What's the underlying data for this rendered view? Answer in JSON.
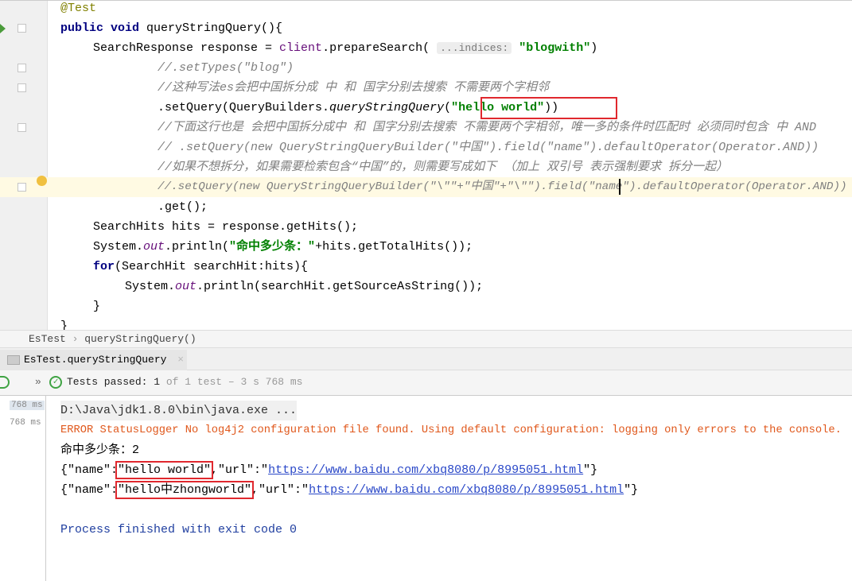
{
  "editor": {
    "lines": [
      {
        "indent": 0,
        "segs": [
          [
            "ann",
            "@Test"
          ]
        ]
      },
      {
        "indent": 0,
        "segs": [
          [
            "kw",
            "public void "
          ],
          [
            "",
            "queryStringQuery(){"
          ]
        ]
      },
      {
        "indent": 1,
        "segs": [
          [
            "",
            "SearchResponse response = "
          ],
          [
            "fld",
            "client"
          ],
          [
            "",
            ".prepareSearch( "
          ],
          [
            "hint",
            "...indices:"
          ],
          [
            "str",
            " \"blogwith\""
          ],
          [
            "",
            ")"
          ]
        ]
      },
      {
        "indent": 3,
        "segs": [
          [
            "cm",
            "//.setTypes(\"blog\")"
          ]
        ]
      },
      {
        "indent": 3,
        "segs": [
          [
            "cm",
            "//这种写法es会把中国拆分成 中 和 国字分别去搜索 不需要两个字相邻"
          ]
        ]
      },
      {
        "indent": 3,
        "segs": [
          [
            "",
            ".setQuery(QueryBuilders."
          ],
          [
            "it",
            "queryStringQuery"
          ],
          [
            "",
            "("
          ],
          [
            "str",
            "\"hello world\""
          ],
          [
            "",
            "))"
          ]
        ]
      },
      {
        "indent": 3,
        "segs": [
          [
            "cm",
            "//下面这行也是 会把中国拆分成中 和 国字分别去搜索 不需要两个字相邻，唯一多的条件时匹配时 必须同时包含 中 AND"
          ]
        ]
      },
      {
        "indent": 3,
        "segs": [
          [
            "cm",
            "// .setQuery(new QueryStringQueryBuilder(\"中国\").field(\"name\").defaultOperator(Operator.AND))"
          ]
        ]
      },
      {
        "indent": 3,
        "segs": [
          [
            "cm",
            "//如果不想拆分，如果需要检索包含“中国”的，则需要写成如下 （加上 双引号 表示强制要求 拆分一起）"
          ]
        ]
      },
      {
        "indent": 3,
        "segs": [
          [
            "cm",
            "//.setQuery(new QueryStringQueryBuilder(\"\\\"\"+\"中国\"+\"\\\"\").field(\"name\").defaultOperator(Operator.AND))"
          ]
        ]
      },
      {
        "indent": 3,
        "segs": [
          [
            "",
            ".get();"
          ]
        ]
      },
      {
        "indent": 1,
        "segs": [
          [
            "",
            "SearchHits hits = response.getHits();"
          ]
        ]
      },
      {
        "indent": 1,
        "segs": [
          [
            "",
            "System."
          ],
          [
            "fld it",
            "out"
          ],
          [
            "",
            ".println("
          ],
          [
            "str",
            "\"命中多少条：\""
          ],
          [
            "",
            "+hits.getTotalHits());"
          ]
        ]
      },
      {
        "indent": 1,
        "segs": [
          [
            "kw",
            "for"
          ],
          [
            "",
            "(SearchHit searchHit:hits){"
          ]
        ]
      },
      {
        "indent": 2,
        "segs": [
          [
            "",
            "System."
          ],
          [
            "fld it",
            "out"
          ],
          [
            "",
            ".println(searchHit.getSourceAsString());"
          ]
        ]
      },
      {
        "indent": 1,
        "segs": [
          [
            "",
            "}"
          ]
        ]
      },
      {
        "indent": 0,
        "segs": [
          [
            "",
            "}"
          ]
        ]
      }
    ]
  },
  "breadcrumb": {
    "class": "EsTest",
    "method": "queryStringQuery()"
  },
  "run_tab": {
    "label": "EsTest.queryStringQuery"
  },
  "toolbar": {
    "status_bold": "Tests passed:",
    "count": "1",
    "rest": " of 1 test – 3 s 768 ms"
  },
  "side": {
    "t1": "768 ms",
    "t2": "768 ms"
  },
  "console": {
    "cmd": "D:\\Java\\jdk1.8.0\\bin\\java.exe ...",
    "error": "ERROR StatusLogger No log4j2 configuration file found. Using default configuration: logging only errors to the console.",
    "count_line": "命中多少条：2",
    "r1_pre": "{\"name\":",
    "r1_val": "\"hello world\"",
    "r1_mid": ",\"url\":\"",
    "r1_url": "https://www.baidu.com/xbq8080/p/8995051.html",
    "r1_end": "\"}",
    "r2_pre": "{\"name\":",
    "r2_val": "\"hello中zhongworld\"",
    "r2_mid": ",\"url\":\"",
    "r2_url": "https://www.baidu.com/xbq8080/p/8995051.html",
    "r2_end": "\"}",
    "exit": "Process finished with exit code 0"
  },
  "colors": {
    "highlight_box": "#e0282e",
    "pass_green": "#3fa343",
    "error": "#e0581c"
  }
}
